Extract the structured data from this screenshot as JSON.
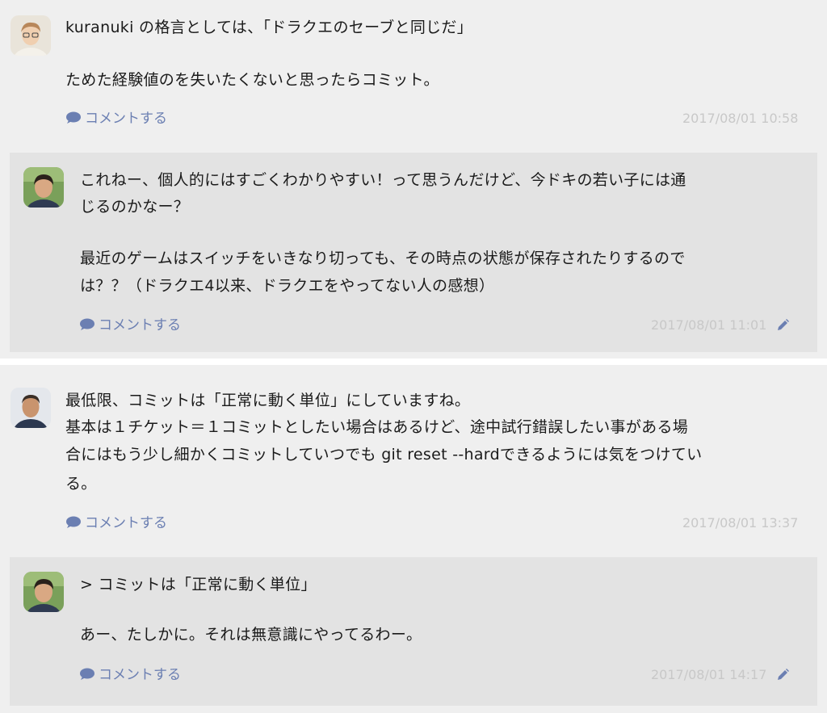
{
  "comments": [
    {
      "lines": [
        "kuranuki の格言としては、「ドラクエのセーブと同じだ」",
        "ためた経験値のを失いたくないと思ったらコミット。"
      ],
      "action_label": "コメントする",
      "timestamp": "2017/08/01 10:58",
      "reply": {
        "lines": [
          "これねー、個人的にはすごくわかりやすい！って思うんだけど、今ドキの若い子には通",
          "じるのかなー？",
          "最近のゲームはスイッチをいきなり切っても、その時点の状態が保存されたりするので",
          "は？？（ドラクエ4以来、ドラクエをやってない人の感想）"
        ],
        "action_label": "コメントする",
        "timestamp": "2017/08/01 11:01"
      }
    },
    {
      "lines": [
        "最低限、コミットは「正常に動く単位」にしていますね。",
        "基本は１チケット＝１コミットとしたい場合はあるけど、途中試行錯誤したい事がある場",
        "合にはもう少し細かくコミットしていつでも git reset --hardできるようには気をつけてい",
        "る。"
      ],
      "action_label": "コメントする",
      "timestamp": "2017/08/01 13:37",
      "reply": {
        "lines": [
          "> コミットは「正常に動く単位」",
          "あー、たしかに。それは無意識にやってるわー。"
        ],
        "action_label": "コメントする",
        "timestamp": "2017/08/01 14:17"
      }
    }
  ],
  "icons": {
    "comment": "speech-bubble-icon",
    "edit": "pencil-icon"
  },
  "colors": {
    "background": "#efefef",
    "reply_background": "#e3e3e3",
    "link": "#6b7fb2",
    "timestamp": "#c8c8c8"
  }
}
